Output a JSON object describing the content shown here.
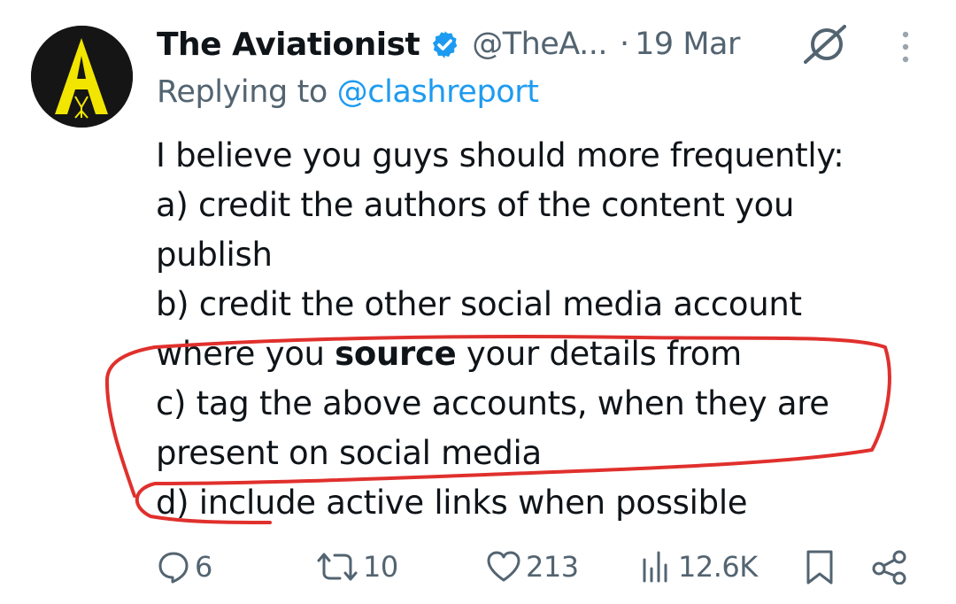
{
  "author": {
    "display_name": "The Aviationist",
    "handle": "@TheA...",
    "separator": "·",
    "date": "19 Mar",
    "avatar_letter": "A"
  },
  "reply": {
    "prefix": "Replying to ",
    "handle": "@clashreport"
  },
  "tweet": {
    "line1": "I believe you guys should more frequently:",
    "line2": "a) credit the authors of the content you",
    "line3": "publish",
    "line4": "b) credit the other social media account",
    "line5_pre": "where you ",
    "line5_bold": "source",
    "line5_post": " your details from",
    "line6": "c) tag the above accounts, when they are",
    "line7": "present on social media",
    "line8": "d) include active links when possible"
  },
  "actions": {
    "replies": "6",
    "reposts": "10",
    "likes": "213",
    "views": "12.6K"
  },
  "colors": {
    "secondary_text": "#536471",
    "link": "#1d9bf0",
    "verified_badge": "#1d9bf0",
    "annotation_red": "#e0302d",
    "avatar_yellow": "#f2e600"
  }
}
